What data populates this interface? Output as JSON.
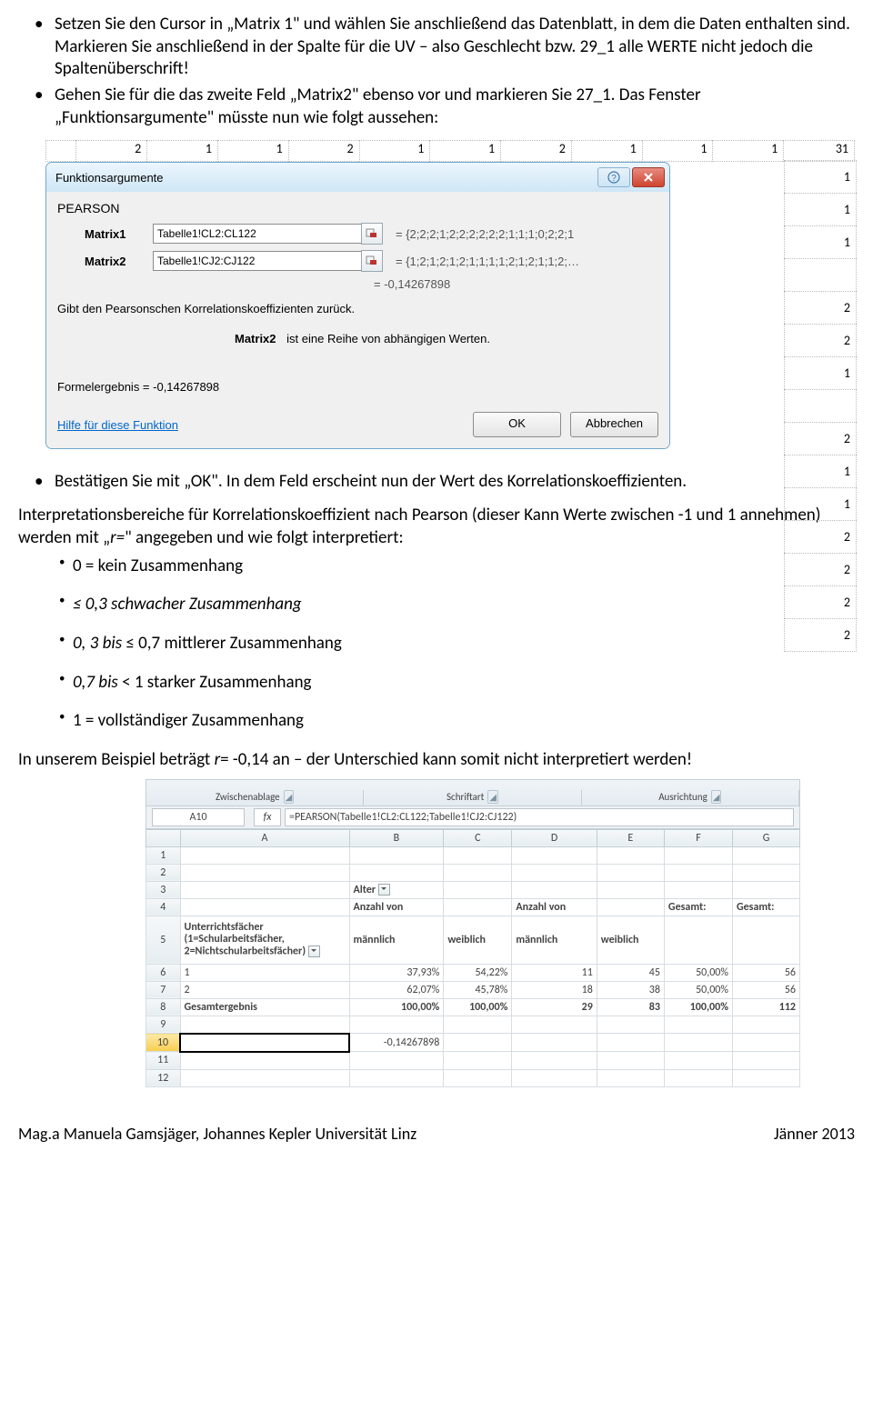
{
  "text": {
    "b1": "Setzen Sie den Cursor in „Matrix 1\" und wählen Sie anschließend das Datenblatt, in dem die Daten enthalten sind. Markieren Sie anschließend in der Spalte für die UV – also Geschlecht bzw. 29_1 alle WERTE nicht jedoch die Spaltenüberschrift!",
    "b2": "Gehen Sie für die das zweite Feld „Matrix2\" ebenso vor und markieren Sie 27_1. Das Fenster „Funktionsargumente\" müsste nun wie folgt aussehen:",
    "b3": "Bestätigen Sie mit „OK\". In dem Feld erscheint nun der Wert des Korrelationskoeffizienten.",
    "interp_intro_a": "Interpretationsbereiche für Korrelationskoeffizient nach Pearson (dieser Kann Werte zwischen -1 und 1 annehmen) werden mit „",
    "interp_intro_b": "r=",
    "interp_intro_c": "\" angegeben und wie folgt interpretiert:",
    "s1": "0 = kein Zusammenhang",
    "s2": "≤ 0,3 schwacher Zusammenhang",
    "s3_a": "0, 3 bis",
    "s3_b": " ≤ 0,7 mittlerer Zusammenhang",
    "s4_a": "0,7 bis",
    "s4_b": "  < 1 starker Zusammenhang",
    "s5": "1 = vollständiger Zusammenhang",
    "concl_a": "In unserem Beispiel  beträgt  ",
    "concl_b": "r",
    "concl_c": "= -0,14 an – der Unterschied kann somit nicht interpretiert werden!",
    "foot_l": "Mag.a Manuela Gamsjäger, Johannes Kepler Universität Linz",
    "foot_r": "Jänner 2013"
  },
  "dialog": {
    "title": "Funktionsargumente",
    "fn": "PEARSON",
    "arg1_label": "Matrix1",
    "arg1_value": "Tabelle1!CL2:CL122",
    "arg1_eq": "=   {2;2;2;1;2;2;2;2;2;2;1;1;1;0;2;2;1",
    "arg2_label": "Matrix2",
    "arg2_value": "Tabelle1!CJ2:CJ122",
    "arg2_eq": "=   {1;2;1;2;1;2;1;1;1;1;2;1;2;1;1;2;…",
    "result_eq": "=   -0,14267898",
    "desc1": "Gibt den Pearsonschen Korrelationskoeffizienten zurück.",
    "desc2_bold": "Matrix2",
    "desc2_rest": "  ist eine Reihe von abhängigen Werten.",
    "formel": "Formelergebnis =   -0,14267898",
    "help": "Hilfe für diese Funktion",
    "ok": "OK",
    "cancel": "Abbrechen",
    "top_cells": [
      "2",
      "1",
      "1",
      "2",
      "1",
      "1",
      "2",
      "1",
      "1",
      "1",
      "31"
    ],
    "top_last": "1",
    "side_cells": [
      "1",
      "1",
      "1",
      "",
      "2",
      "2",
      "1",
      "",
      "2",
      "1",
      "1",
      "2",
      "2",
      "2",
      "2"
    ]
  },
  "sheet": {
    "rib1": "Zwischenablage",
    "rib2": "Schriftart",
    "rib3": "Ausrichtung",
    "namebox": "A10",
    "fx_label": "fx",
    "formula": "=PEARSON(Tabelle1!CL2:CL122;Tabelle1!CJ2:CJ122)",
    "cols": [
      "",
      "A",
      "B",
      "C",
      "D",
      "E",
      "F",
      "G"
    ],
    "r3_b": "Alter",
    "r4_b": "Anzahl von",
    "r4_d": "Anzahl von",
    "r4_f": "Gesamt:",
    "r4_g": "Gesamt:",
    "r5_a": "Unterrichtsfächer (1=Schularbeitsfächer, 2=Nichtschularbeitsfächer)",
    "r5_b": "männlich",
    "r5_c": "weiblich",
    "r5_d": "männlich",
    "r5_e": "weiblich",
    "r6": [
      "6",
      "1",
      "37,93%",
      "54,22%",
      "11",
      "45",
      "50,00%",
      "56"
    ],
    "r7": [
      "7",
      "2",
      "62,07%",
      "45,78%",
      "18",
      "38",
      "50,00%",
      "56"
    ],
    "r8": [
      "8",
      "Gesamtergebnis",
      "100,00%",
      "100,00%",
      "29",
      "83",
      "100,00%",
      "112"
    ],
    "r10_b": "-0,14267898"
  }
}
